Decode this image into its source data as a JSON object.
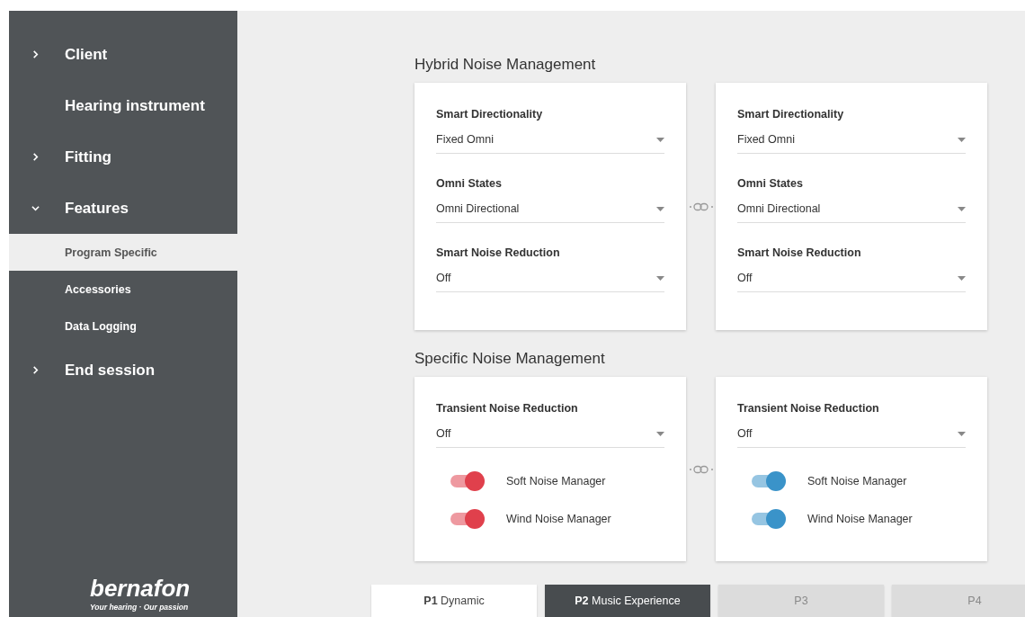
{
  "sidebar": {
    "items": [
      {
        "label": "Client",
        "expanded": false
      },
      {
        "label": "Hearing instrument"
      },
      {
        "label": "Fitting",
        "expanded": false
      },
      {
        "label": "Features",
        "expanded": true,
        "children": [
          {
            "label": "Program Specific",
            "selected": true
          },
          {
            "label": "Accessories",
            "selected": false
          },
          {
            "label": "Data Logging",
            "selected": false
          }
        ]
      },
      {
        "label": "End session",
        "expanded": false
      }
    ],
    "logo": {
      "name": "bernafon",
      "tagline": "Your hearing · Our passion"
    }
  },
  "sections": [
    {
      "title": "Hybrid Noise Management",
      "sides": [
        {
          "settings": [
            {
              "kind": "dropdown",
              "label": "Smart Directionality",
              "value": "Fixed Omni"
            },
            {
              "kind": "dropdown",
              "label": "Omni States",
              "value": "Omni Directional"
            },
            {
              "kind": "dropdown",
              "label": "Smart Noise Reduction",
              "value": "Off"
            }
          ]
        },
        {
          "settings": [
            {
              "kind": "dropdown",
              "label": "Smart Directionality",
              "value": "Fixed Omni"
            },
            {
              "kind": "dropdown",
              "label": "Omni States",
              "value": "Omni Directional"
            },
            {
              "kind": "dropdown",
              "label": "Smart Noise Reduction",
              "value": "Off"
            }
          ]
        }
      ]
    },
    {
      "title": "Specific Noise Management",
      "sides": [
        {
          "settings": [
            {
              "kind": "dropdown",
              "label": "Transient Noise Reduction",
              "value": "Off"
            },
            {
              "kind": "toggle",
              "label": "Soft Noise Manager",
              "on": true,
              "color": "#e0404c"
            },
            {
              "kind": "toggle",
              "label": "Wind Noise Manager",
              "on": true,
              "color": "#e0404c"
            }
          ]
        },
        {
          "settings": [
            {
              "kind": "dropdown",
              "label": "Transient Noise Reduction",
              "value": "Off"
            },
            {
              "kind": "toggle",
              "label": "Soft Noise Manager",
              "on": true,
              "color": "#3a93c9"
            },
            {
              "kind": "toggle",
              "label": "Wind Noise Manager",
              "on": true,
              "color": "#3a93c9"
            }
          ]
        }
      ]
    }
  ],
  "programs": [
    {
      "label": "**P1** Dynamic",
      "selected": false,
      "disabled": false
    },
    {
      "label": "**P2** Music Experience",
      "selected": true,
      "disabled": false
    },
    {
      "label": "P3",
      "selected": false,
      "disabled": true
    },
    {
      "label": "P4",
      "selected": false,
      "disabled": true
    }
  ]
}
